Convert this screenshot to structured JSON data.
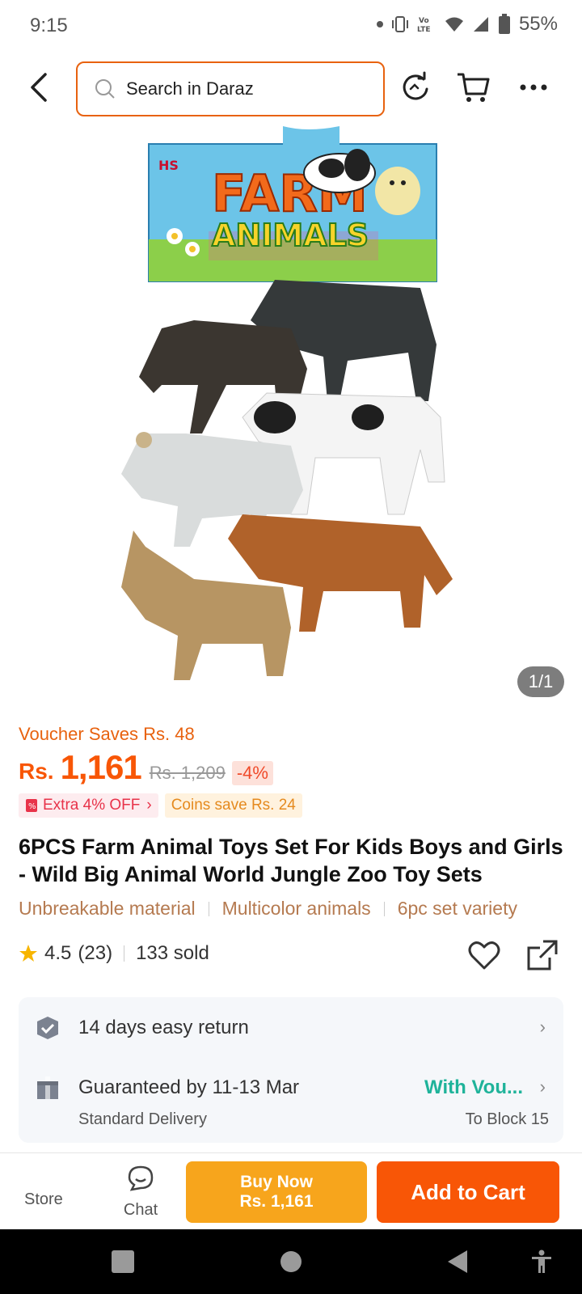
{
  "status_bar": {
    "time": "9:15",
    "battery": "55%",
    "icons": [
      "dot-icon",
      "vibrate-icon",
      "volte-icon",
      "wifi-icon",
      "signal-icon",
      "battery-icon"
    ],
    "volte_label": "Vo LTE"
  },
  "header": {
    "back_icon": "chevron-left-icon",
    "search_placeholder": "Search in Daraz",
    "icons": [
      "refresh-icon",
      "cart-icon",
      "more-icon"
    ]
  },
  "product_image": {
    "package_text_line1": "FARM",
    "package_text_line2": "ANIMALS",
    "brand": "HS",
    "counter": "1/1"
  },
  "pricing": {
    "voucher": "Voucher Saves Rs. 48",
    "currency": "Rs.",
    "price": "1,161",
    "original_price": "Rs. 1,209",
    "discount": "-4%",
    "promo_extra": "Extra 4% OFF",
    "promo_coins": "Coins save Rs. 24"
  },
  "product": {
    "title": "6PCS Farm Animal Toys Set For Kids Boys and Girls - Wild Big Animal World Jungle Zoo Toy Sets",
    "features": [
      "Unbreakable material",
      "Multicolor animals",
      "6pc set variety"
    ],
    "rating": "4.5",
    "reviews": "(23)",
    "sold": "133 sold"
  },
  "service": {
    "return_label": "14 days easy return",
    "delivery_label": "Guaranteed by 11-13 Mar",
    "delivery_type": "Standard Delivery",
    "delivery_accent": "With Vou...",
    "delivery_location": "To Block 15"
  },
  "action_bar": {
    "store_label": "Store",
    "chat_label": "Chat",
    "buy_now_line1": "Buy Now",
    "buy_now_line2": "Rs. 1,161",
    "add_to_cart": "Add to Cart"
  },
  "colors": {
    "accent_orange": "#f85606",
    "buy_now": "#f7a51c",
    "teal": "#1fb39a",
    "feature_brown": "#b57a50"
  }
}
